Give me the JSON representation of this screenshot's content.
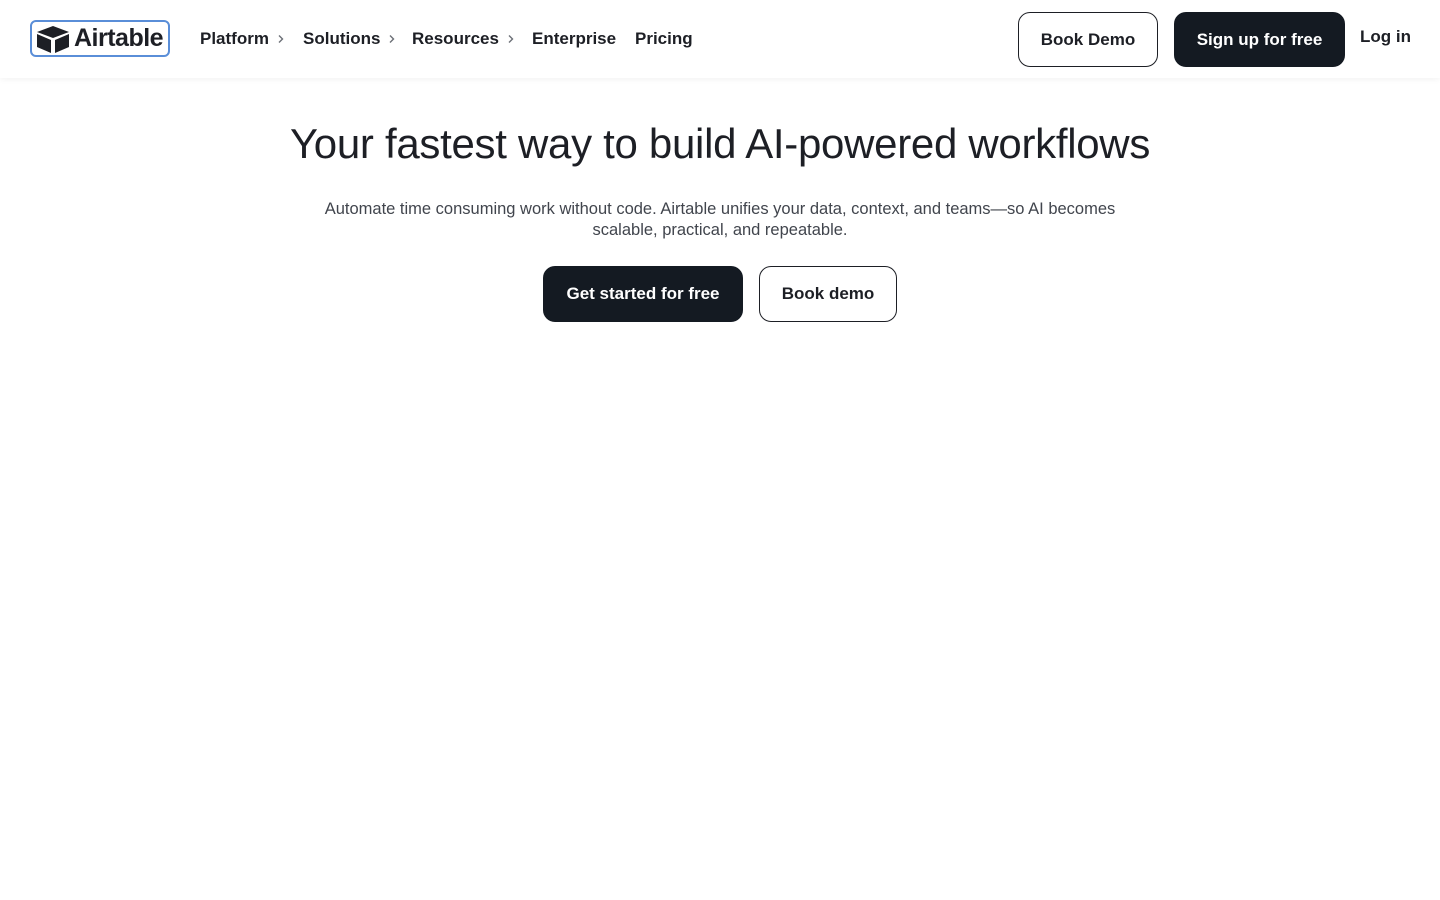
{
  "brand": {
    "name": "Airtable",
    "logo_icon": "airtable-cube-icon"
  },
  "nav": {
    "items": [
      {
        "label": "Platform",
        "has_submenu": true
      },
      {
        "label": "Solutions",
        "has_submenu": true
      },
      {
        "label": "Resources",
        "has_submenu": true
      },
      {
        "label": "Enterprise",
        "has_submenu": false
      },
      {
        "label": "Pricing",
        "has_submenu": false
      }
    ],
    "book_demo_label": "Book Demo",
    "signup_label": "Sign up for free",
    "login_label": "Log in"
  },
  "hero": {
    "title": "Your fastest way to build AI-powered workflows",
    "subtitle_line1": "Automate time consuming work without code. Airtable unifies your data, context, and teams—so AI becomes",
    "subtitle_line2": "scalable, practical, and repeatable.",
    "primary_cta": "Get started for free",
    "secondary_cta": "Book demo"
  },
  "colors": {
    "text": "#1d1f25",
    "dark_button": "#141a22",
    "logo_focus_ring": "#5a8ed8",
    "subtitle_text": "#41454d"
  }
}
